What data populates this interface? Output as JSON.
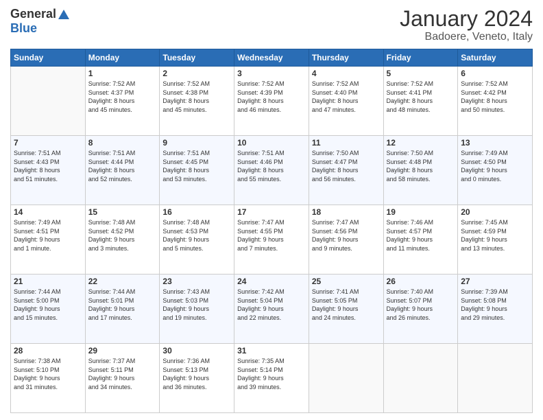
{
  "logo": {
    "general": "General",
    "blue": "Blue"
  },
  "title": "January 2024",
  "subtitle": "Badoere, Veneto, Italy",
  "headers": [
    "Sunday",
    "Monday",
    "Tuesday",
    "Wednesday",
    "Thursday",
    "Friday",
    "Saturday"
  ],
  "weeks": [
    [
      {
        "day": "",
        "info": ""
      },
      {
        "day": "1",
        "info": "Sunrise: 7:52 AM\nSunset: 4:37 PM\nDaylight: 8 hours\nand 45 minutes."
      },
      {
        "day": "2",
        "info": "Sunrise: 7:52 AM\nSunset: 4:38 PM\nDaylight: 8 hours\nand 45 minutes."
      },
      {
        "day": "3",
        "info": "Sunrise: 7:52 AM\nSunset: 4:39 PM\nDaylight: 8 hours\nand 46 minutes."
      },
      {
        "day": "4",
        "info": "Sunrise: 7:52 AM\nSunset: 4:40 PM\nDaylight: 8 hours\nand 47 minutes."
      },
      {
        "day": "5",
        "info": "Sunrise: 7:52 AM\nSunset: 4:41 PM\nDaylight: 8 hours\nand 48 minutes."
      },
      {
        "day": "6",
        "info": "Sunrise: 7:52 AM\nSunset: 4:42 PM\nDaylight: 8 hours\nand 50 minutes."
      }
    ],
    [
      {
        "day": "7",
        "info": "Sunrise: 7:51 AM\nSunset: 4:43 PM\nDaylight: 8 hours\nand 51 minutes."
      },
      {
        "day": "8",
        "info": "Sunrise: 7:51 AM\nSunset: 4:44 PM\nDaylight: 8 hours\nand 52 minutes."
      },
      {
        "day": "9",
        "info": "Sunrise: 7:51 AM\nSunset: 4:45 PM\nDaylight: 8 hours\nand 53 minutes."
      },
      {
        "day": "10",
        "info": "Sunrise: 7:51 AM\nSunset: 4:46 PM\nDaylight: 8 hours\nand 55 minutes."
      },
      {
        "day": "11",
        "info": "Sunrise: 7:50 AM\nSunset: 4:47 PM\nDaylight: 8 hours\nand 56 minutes."
      },
      {
        "day": "12",
        "info": "Sunrise: 7:50 AM\nSunset: 4:48 PM\nDaylight: 8 hours\nand 58 minutes."
      },
      {
        "day": "13",
        "info": "Sunrise: 7:49 AM\nSunset: 4:50 PM\nDaylight: 9 hours\nand 0 minutes."
      }
    ],
    [
      {
        "day": "14",
        "info": "Sunrise: 7:49 AM\nSunset: 4:51 PM\nDaylight: 9 hours\nand 1 minute."
      },
      {
        "day": "15",
        "info": "Sunrise: 7:48 AM\nSunset: 4:52 PM\nDaylight: 9 hours\nand 3 minutes."
      },
      {
        "day": "16",
        "info": "Sunrise: 7:48 AM\nSunset: 4:53 PM\nDaylight: 9 hours\nand 5 minutes."
      },
      {
        "day": "17",
        "info": "Sunrise: 7:47 AM\nSunset: 4:55 PM\nDaylight: 9 hours\nand 7 minutes."
      },
      {
        "day": "18",
        "info": "Sunrise: 7:47 AM\nSunset: 4:56 PM\nDaylight: 9 hours\nand 9 minutes."
      },
      {
        "day": "19",
        "info": "Sunrise: 7:46 AM\nSunset: 4:57 PM\nDaylight: 9 hours\nand 11 minutes."
      },
      {
        "day": "20",
        "info": "Sunrise: 7:45 AM\nSunset: 4:59 PM\nDaylight: 9 hours\nand 13 minutes."
      }
    ],
    [
      {
        "day": "21",
        "info": "Sunrise: 7:44 AM\nSunset: 5:00 PM\nDaylight: 9 hours\nand 15 minutes."
      },
      {
        "day": "22",
        "info": "Sunrise: 7:44 AM\nSunset: 5:01 PM\nDaylight: 9 hours\nand 17 minutes."
      },
      {
        "day": "23",
        "info": "Sunrise: 7:43 AM\nSunset: 5:03 PM\nDaylight: 9 hours\nand 19 minutes."
      },
      {
        "day": "24",
        "info": "Sunrise: 7:42 AM\nSunset: 5:04 PM\nDaylight: 9 hours\nand 22 minutes."
      },
      {
        "day": "25",
        "info": "Sunrise: 7:41 AM\nSunset: 5:05 PM\nDaylight: 9 hours\nand 24 minutes."
      },
      {
        "day": "26",
        "info": "Sunrise: 7:40 AM\nSunset: 5:07 PM\nDaylight: 9 hours\nand 26 minutes."
      },
      {
        "day": "27",
        "info": "Sunrise: 7:39 AM\nSunset: 5:08 PM\nDaylight: 9 hours\nand 29 minutes."
      }
    ],
    [
      {
        "day": "28",
        "info": "Sunrise: 7:38 AM\nSunset: 5:10 PM\nDaylight: 9 hours\nand 31 minutes."
      },
      {
        "day": "29",
        "info": "Sunrise: 7:37 AM\nSunset: 5:11 PM\nDaylight: 9 hours\nand 34 minutes."
      },
      {
        "day": "30",
        "info": "Sunrise: 7:36 AM\nSunset: 5:13 PM\nDaylight: 9 hours\nand 36 minutes."
      },
      {
        "day": "31",
        "info": "Sunrise: 7:35 AM\nSunset: 5:14 PM\nDaylight: 9 hours\nand 39 minutes."
      },
      {
        "day": "",
        "info": ""
      },
      {
        "day": "",
        "info": ""
      },
      {
        "day": "",
        "info": ""
      }
    ]
  ]
}
